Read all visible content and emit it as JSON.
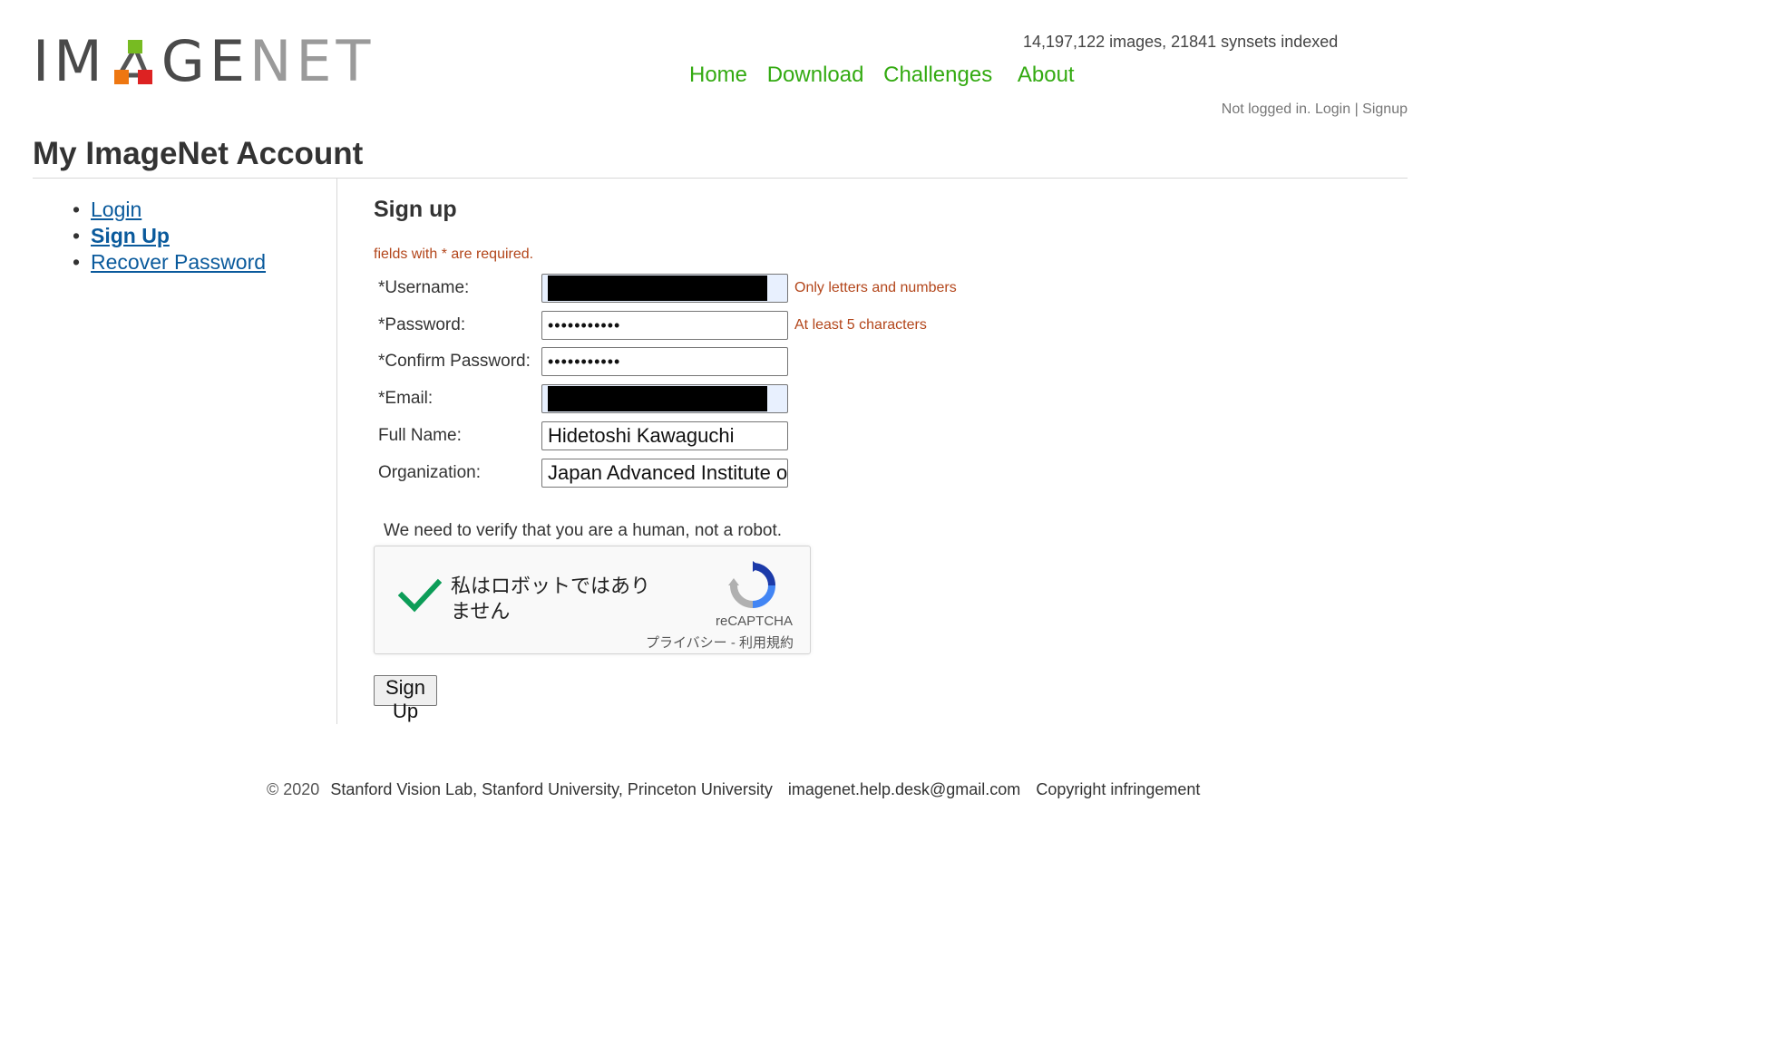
{
  "header": {
    "logo_text_part1": "IM",
    "logo_text_part2": "GE",
    "logo_text_part3": "NET",
    "stats": "14,197,122 images, 21841 synsets indexed",
    "nav": [
      "Home",
      "Download",
      "Challenges",
      "About"
    ],
    "auth_status": "Not logged in.",
    "auth_login": "Login",
    "auth_separator": "|",
    "auth_signup": "Signup",
    "nav_color": "#33aa11"
  },
  "page_title": "My ImageNet Account",
  "sidebar": {
    "items": [
      {
        "label": "Login",
        "active": false
      },
      {
        "label": "Sign Up",
        "active": true
      },
      {
        "label": "Recover Password",
        "active": false
      }
    ]
  },
  "form": {
    "title": "Sign up",
    "required_note": "fields with * are required.",
    "fields": [
      {
        "label": "*Username:",
        "value": "",
        "hint": "Only letters and numbers"
      },
      {
        "label": "*Password:",
        "value": "•••••••••••",
        "hint": "At least 5 characters"
      },
      {
        "label": "*Confirm Password:",
        "value": "•••••••••••",
        "hint": ""
      },
      {
        "label": "*Email:",
        "value": "",
        "hint": ""
      },
      {
        "label": "Full Name:",
        "value": "Hidetoshi Kawaguchi",
        "hint": ""
      },
      {
        "label": "Organization:",
        "value": "Japan Advanced Institute o",
        "hint": ""
      }
    ],
    "verify_text": "We need to verify that you are a human, not a robot.",
    "captcha": {
      "label": "私はロボットではありません",
      "brand": "reCAPTCHA",
      "privacy": "プライバシー",
      "separator": "-",
      "terms": "利用規約",
      "checked": true
    },
    "submit_label": "Sign Up",
    "hint_color": "#b3461b"
  },
  "footer": {
    "copyright": "© 2020",
    "orgs": "Stanford Vision Lab, Stanford University, Princeton University",
    "email": "imagenet.help.desk@gmail.com",
    "infringement": "Copyright infringement"
  }
}
